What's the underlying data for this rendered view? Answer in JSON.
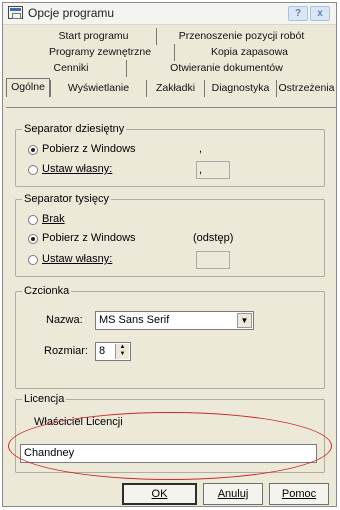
{
  "window": {
    "title": "Opcje programu",
    "help_button": "?",
    "close_button": "x"
  },
  "tabs": {
    "row1": [
      "Start programu",
      "Przenoszenie pozycji robót"
    ],
    "row2": [
      "Programy zewnętrzne",
      "Kopia zapasowa"
    ],
    "row3": [
      "Cenniki",
      "Otwieranie dokumentów"
    ],
    "row4": [
      "Ogólne",
      "Wyświetlanie",
      "Zakładki",
      "Diagnostyka",
      "Ostrzeżenia"
    ],
    "active": "Ogólne"
  },
  "decimal_separator": {
    "legend": "Separator dziesiętny",
    "option_windows": "Pobierz z Windows",
    "option_custom": "Ustaw własny:",
    "windows_value": ",",
    "custom_value": ",",
    "selected": "Pobierz z Windows"
  },
  "thousands_separator": {
    "legend": "Separator tysięcy",
    "option_none": "Brak",
    "option_windows": "Pobierz z Windows",
    "windows_value": "(odstęp)",
    "option_custom": "Ustaw własny:",
    "custom_value": "",
    "selected": "Pobierz z Windows"
  },
  "font": {
    "legend": "Czcionka",
    "name_label": "Nazwa:",
    "name_value": "MS Sans Serif",
    "size_label": "Rozmiar:",
    "size_value": "8"
  },
  "license": {
    "legend": "Licencja",
    "owner_label": "Właściciel Licencji",
    "owner_value": "Chandney"
  },
  "buttons": {
    "ok": "OK",
    "cancel": "Anuluj",
    "help": "Pomoc"
  },
  "colors": {
    "dialog_bg": "#ece9d8",
    "annotation": "#c9282d"
  },
  "icons": [
    "app-icon",
    "help-icon",
    "close-icon",
    "dropdown-arrow-icon",
    "spin-up-icon",
    "spin-down-icon"
  ]
}
